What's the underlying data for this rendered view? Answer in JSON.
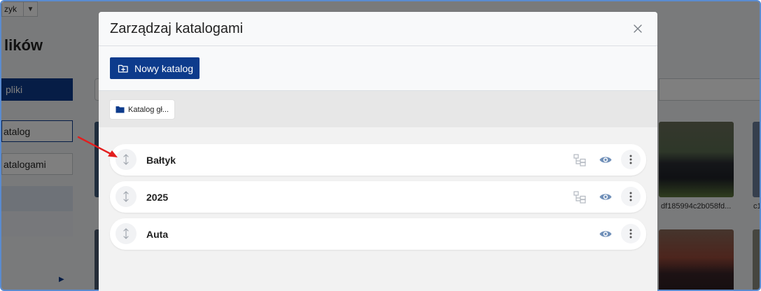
{
  "background": {
    "language": "zyk",
    "page_title": "lików",
    "primary_button": "pliki",
    "catalog_button": "atalog",
    "manage_button": "atalogami",
    "captions": [
      "df185994c2b058fd...",
      "c1"
    ]
  },
  "modal": {
    "title": "Zarządzaj katalogami",
    "new_catalog_label": "Nowy katalog",
    "breadcrumb_label": "Katalog gł...",
    "folders": [
      {
        "name": "Bałtyk",
        "has_tree_action": true
      },
      {
        "name": "2025",
        "has_tree_action": true
      },
      {
        "name": "Auta",
        "has_tree_action": false
      }
    ]
  },
  "colors": {
    "primary": "#0d3b8c",
    "icon_gray": "#9aa3ad",
    "eye_blue": "#6f8fb8",
    "annotation_arrow": "#e31e1e"
  },
  "icons": {
    "close": "close-icon",
    "new_folder": "folder-plus-icon",
    "breadcrumb_folder": "folder-icon",
    "drag": "drag-vertical-icon",
    "tree": "folder-tree-icon",
    "eye": "eye-icon",
    "more": "more-vertical-icon"
  }
}
